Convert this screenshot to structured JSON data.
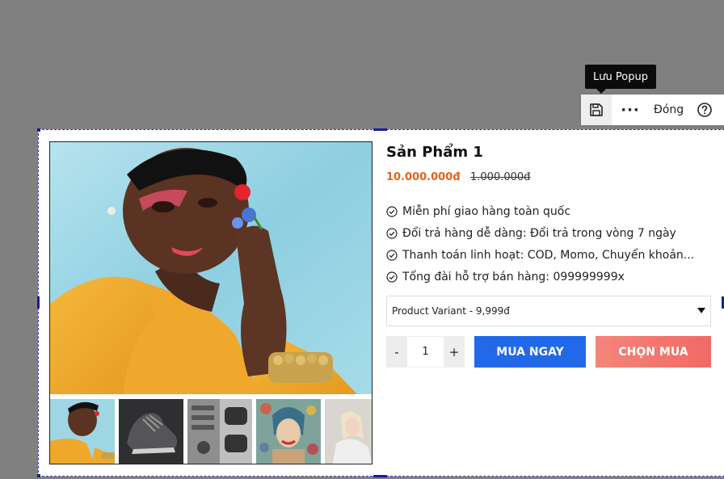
{
  "tooltip": {
    "text": "Lưu Popup"
  },
  "toolbar": {
    "save_icon": "save-icon",
    "more_label": "···",
    "close_label": "Đóng",
    "help_icon": "help-icon"
  },
  "product": {
    "title": "Sản Phẩm 1",
    "price": "10.000.000đ",
    "old_price": "1.000.000đ",
    "features": [
      "Miễn phí giao hàng toàn quốc",
      "Đổi trả hàng dễ dàng: Đổi trả trong vòng 7 ngày",
      "Thanh toán linh hoạt: COD, Momo, Chuyển khoản...",
      "Tổng đài hỗ trợ bán hàng: 099999999x"
    ],
    "variant": "Product Variant - 9,999đ",
    "qty_minus": "-",
    "qty_value": "1",
    "qty_plus": "+",
    "buy_now_label": "MUA NGAY",
    "choose_label": "CHỌN MUA"
  },
  "colors": {
    "price": "#e3621c",
    "buy_button": "#2169e8",
    "choose_button": "#f06a64",
    "canvas_bg": "#808080"
  }
}
